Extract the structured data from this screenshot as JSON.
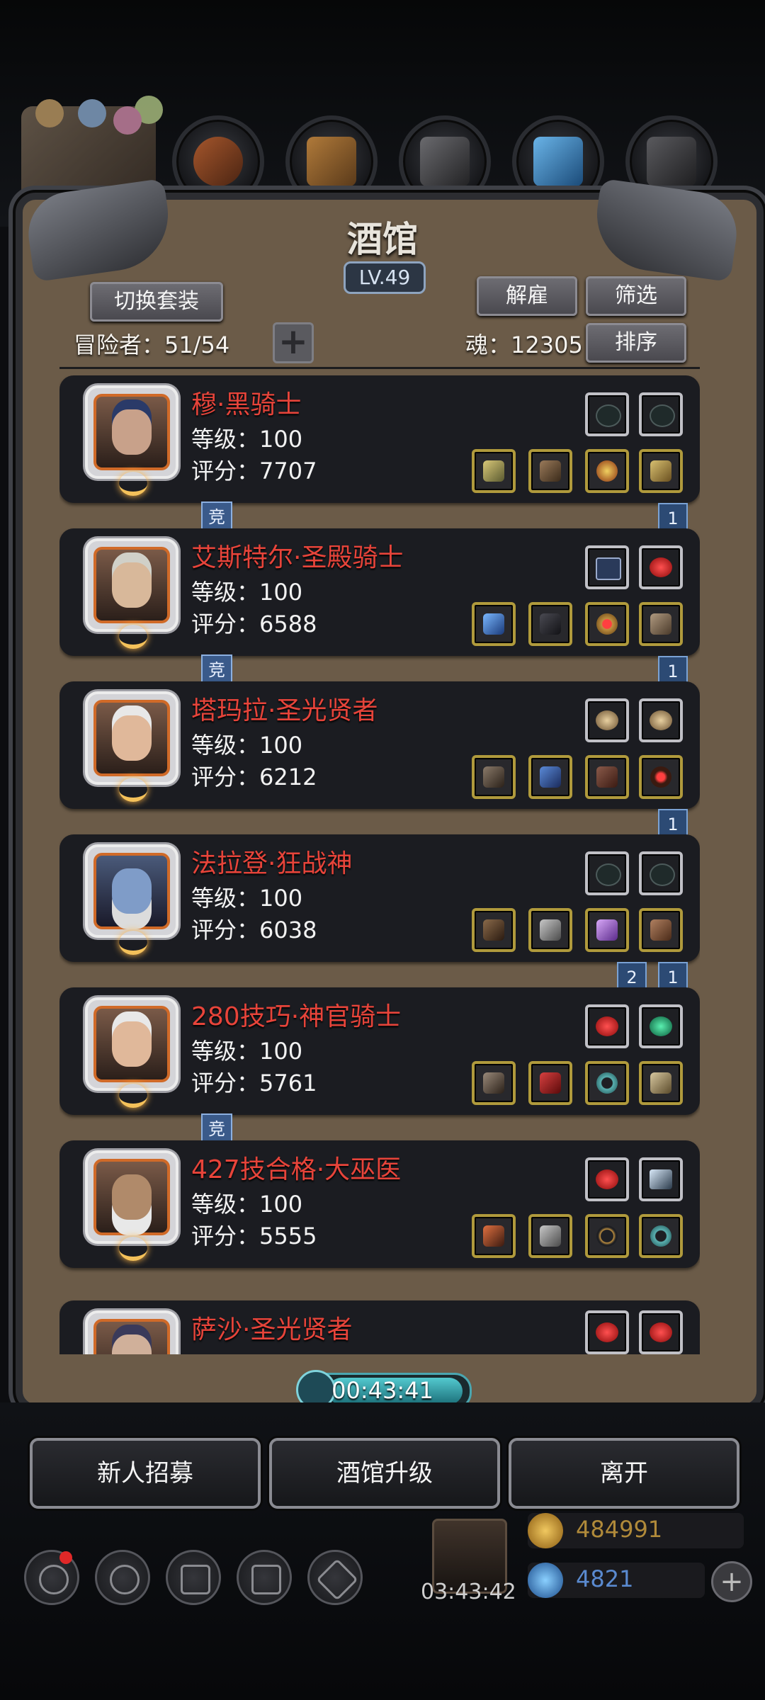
{
  "header": {
    "title": "酒馆",
    "level": "LV.49",
    "switch_outfit": "切换套装",
    "dismiss": "解雇",
    "filter": "筛选",
    "sort": "排序",
    "adventurers_label": "冒险者：51/54",
    "soul_label": "魂：12305",
    "add": "+"
  },
  "colors": {
    "name_red": "#e7443a",
    "portrait_border": "#d06a28",
    "gear_gold": "#b09a3c",
    "timer_teal": "#4aa6b0"
  },
  "heroes": [
    {
      "name": "穆·黑骑士",
      "level": "等级：100",
      "score": "评分：7707",
      "badge": "竞",
      "ribbons": [
        "1"
      ]
    },
    {
      "name": "艾斯特尔·圣殿骑士",
      "level": "等级：100",
      "score": "评分：6588",
      "badge": "竞",
      "ribbons": [
        "1"
      ]
    },
    {
      "name": "塔玛拉·圣光贤者",
      "level": "等级：100",
      "score": "评分：6212",
      "badge": "",
      "ribbons": [
        "1"
      ]
    },
    {
      "name": "法拉登·狂战神",
      "level": "等级：100",
      "score": "评分：6038",
      "badge": "",
      "ribbons": [
        "2",
        "1"
      ]
    },
    {
      "name": "280技巧·神官骑士",
      "level": "等级：100",
      "score": "评分：5761",
      "badge": "竞",
      "ribbons": []
    },
    {
      "name": "427技合格·大巫医",
      "level": "等级：100",
      "score": "评分：5555",
      "badge": "",
      "ribbons": []
    },
    {
      "name": "萨沙·圣光贤者",
      "level": "",
      "score": "",
      "badge": "",
      "ribbons": []
    }
  ],
  "timer": {
    "value": "00:43:41"
  },
  "actions": {
    "recruit": "新人招募",
    "upgrade": "酒馆升级",
    "leave": "离开"
  },
  "footer": {
    "gift_timer": "03:43:42",
    "gold": "484991",
    "gems": "4821",
    "add": "+"
  },
  "icons": {
    "resources": [
      "ore-icon",
      "wood-icon",
      "iron-icon",
      "crystal-icon",
      "stone-icon"
    ],
    "bottom_nav": [
      "settings-icon",
      "medal-icon",
      "rune-icon",
      "mail-icon",
      "map-icon"
    ]
  }
}
